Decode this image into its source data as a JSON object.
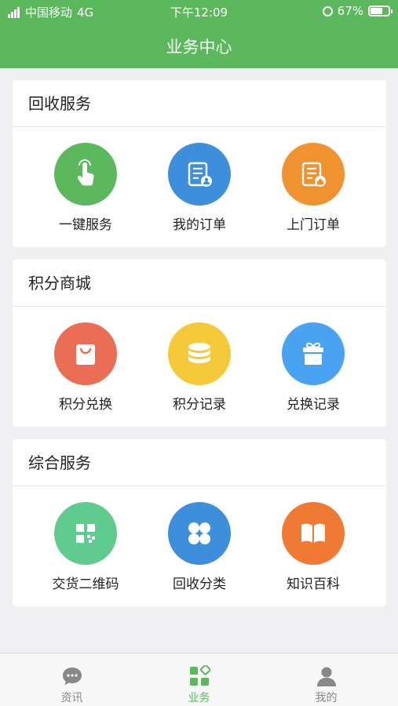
{
  "status_bar": {
    "carrier": "中国移动",
    "network": "4G",
    "time": "下午12:09",
    "battery": "67%",
    "battery_level": 0.67
  },
  "header": {
    "title": "业务中心"
  },
  "sections": [
    {
      "title": "回收服务",
      "items": [
        {
          "label": "一键服务",
          "icon": "hand-tap-icon",
          "color": "#5cb85c"
        },
        {
          "label": "我的订单",
          "icon": "order-user-icon",
          "color": "#3d8fdb"
        },
        {
          "label": "上门订单",
          "icon": "order-home-icon",
          "color": "#f0922f"
        }
      ]
    },
    {
      "title": "积分商城",
      "items": [
        {
          "label": "积分兑换",
          "icon": "shopping-bag-icon",
          "color": "#ea6e56"
        },
        {
          "label": "积分记录",
          "icon": "coin-stack-icon",
          "color": "#f6c93a"
        },
        {
          "label": "兑换记录",
          "icon": "gift-icon",
          "color": "#4aa3f2"
        }
      ]
    },
    {
      "title": "综合服务",
      "items": [
        {
          "label": "交货二维码",
          "icon": "qr-code-icon",
          "color": "#5fcb8f"
        },
        {
          "label": "回收分类",
          "icon": "clover-icon",
          "color": "#3d8fdb"
        },
        {
          "label": "知识百科",
          "icon": "book-icon",
          "color": "#f07a33"
        }
      ]
    }
  ],
  "tab_bar": {
    "tabs": [
      {
        "label": "资讯",
        "icon": "chat-bubble-icon",
        "active": false
      },
      {
        "label": "业务",
        "icon": "grid-apps-icon",
        "active": true
      },
      {
        "label": "我的",
        "icon": "person-icon",
        "active": false
      }
    ],
    "active_color": "#5cb85c",
    "inactive_color": "#888888"
  }
}
